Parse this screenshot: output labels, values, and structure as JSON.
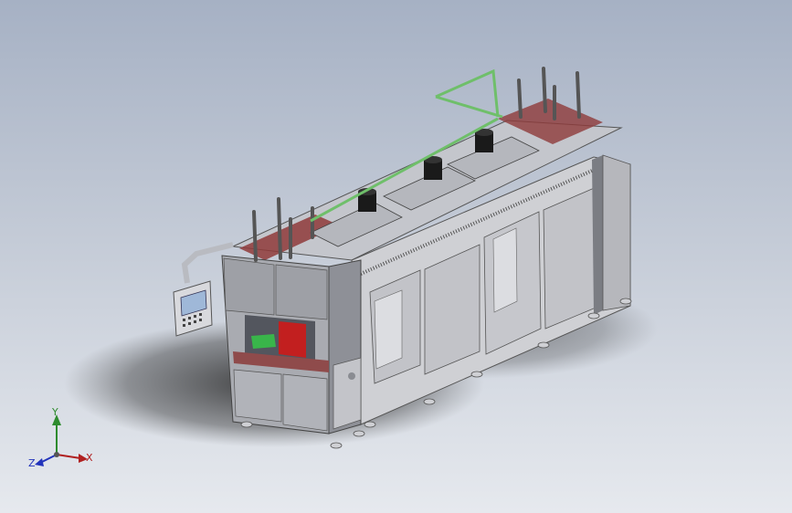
{
  "scene": {
    "subject": "cad-machine-isometric",
    "colors": {
      "background_top": "#a6b1c4",
      "background_bottom": "#e6e9ee",
      "body": "#c9c9cb",
      "frame": "#9a9aa0",
      "accent_red": "#a23b3b",
      "pipe_green": "#6fbf6a",
      "hmi_blue": "#9fb8d8"
    }
  },
  "triad": {
    "x_label": "X",
    "y_label": "Y",
    "z_label": "Z"
  }
}
